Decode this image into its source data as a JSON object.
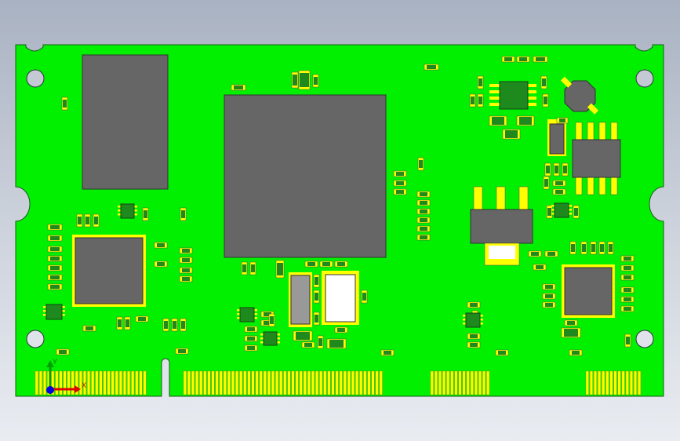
{
  "viewport": {
    "background_top": "#a9b2c2",
    "background_bottom": "#e9ecf1"
  },
  "board": {
    "pcb_color": "#00f000",
    "ic_color": "#666666",
    "pad_color": "#ffff00",
    "part_body_color": "#1e8a1e",
    "crystal_white": "#ffffff",
    "edge_connector_color": "#ffff00"
  },
  "triad": {
    "x_label": "X",
    "y_label": "Y",
    "x_color": "#e00000",
    "y_color": "#00a000",
    "z_color": "#0000e0"
  }
}
